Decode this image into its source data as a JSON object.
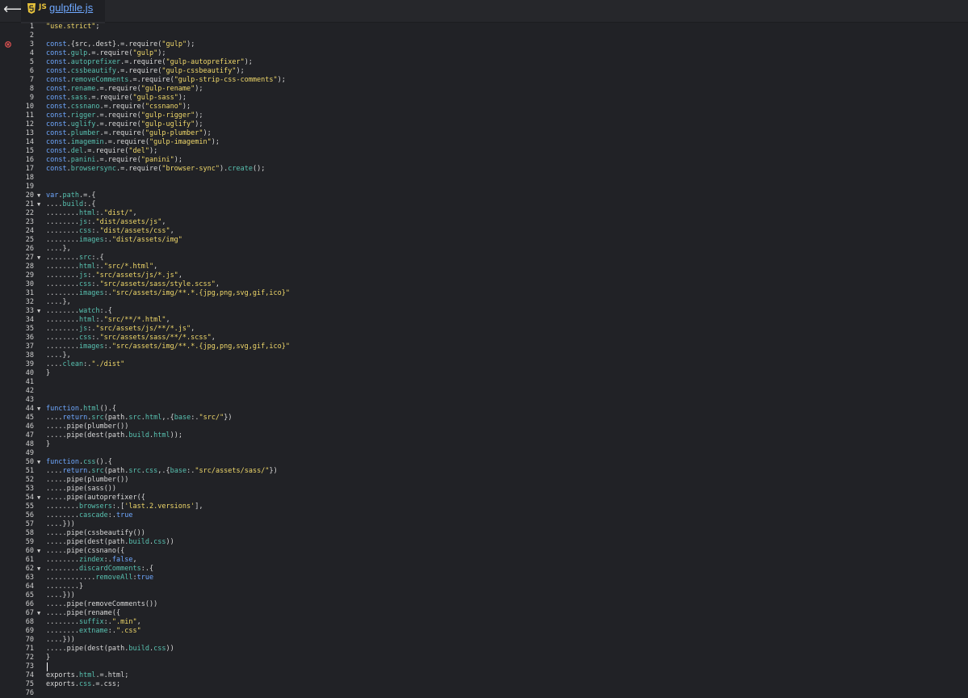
{
  "header": {
    "back_glyph": "⟵",
    "tab": {
      "js_badge": "JS",
      "filename": "gulpfile.js"
    }
  },
  "colors": {
    "background": "#212226",
    "keyword": "#6fa8ff",
    "property": "#58c1b0",
    "string": "#f0d86a",
    "error": "#e05252",
    "text": "#d8d8d8"
  },
  "editor": {
    "error_line": 3,
    "caret_line": 73,
    "fold_lines": [
      20,
      21,
      27,
      33,
      44,
      50,
      54,
      60,
      62,
      67
    ],
    "lines": [
      "\"use.strict\";",
      "",
      "const.{src,.dest}.=.require(\"gulp\");",
      "const.gulp.=.require(\"gulp\");",
      "const.autoprefixer.=.require(\"gulp-autoprefixer\");",
      "const.cssbeautify.=.require(\"gulp-cssbeautify\");",
      "const.removeComments.=.require(\"gulp-strip-css-comments\");",
      "const.rename.=.require(\"gulp-rename\");",
      "const.sass.=.require(\"gulp-sass\");",
      "const.cssnano.=.require(\"cssnano\");",
      "const.rigger.=.require(\"gulp-rigger\");",
      "const.uglify.=.require(\"gulp-uglify\");",
      "const.plumber.=.require(\"gulp-plumber\");",
      "const.imagemin.=.require(\"gulp-imagemin\");",
      "const.del.=.require(\"del\");",
      "const.panini.=.require(\"panini\");",
      "const.browsersync.=.require(\"browser-sync\").create();",
      "",
      "",
      "var.path.=.{",
      "....build:.{",
      "........html:.\"dist/\",",
      "........js:.\"dist/assets/js\",",
      "........css:.\"dist/assets/css\",",
      "........images:.\"dist/assets/img\"",
      "....},",
      "........src:.{",
      "........html:.\"src/*.html\",",
      "........js:.\"src/assets/js/*.js\",",
      "........css:.\"src/assets/sass/style.scss\",",
      "........images:.\"src/assets/img/**.*.{jpg,png,svg,gif,ico}\"",
      "....},",
      "........watch:.{",
      "........html:.\"src/**/*.html\",",
      "........js:.\"src/assets/js/**/*.js\",",
      "........css:.\"src/assets/sass/**/*.scss\",",
      "........images:.\"src/assets/img/**.*.{jpg,png,svg,gif,ico}\"",
      "....},",
      "....clean:.\"./dist\"",
      "}",
      "",
      "",
      "",
      "function.html().{",
      "....return.src(path.src.html,.{base:.\"src/\"})",
      ".....pipe(plumber())",
      ".....pipe(dest(path.build.html));",
      "}",
      "",
      "function.css().{",
      "....return.src(path.src.css,.{base:.\"src/assets/sass/\"})",
      ".....pipe(plumber())",
      ".....pipe(sass())",
      ".....pipe(autoprefixer({",
      "........browsers:.['last.2.versions'],",
      "........cascade:.true",
      "....}))",
      ".....pipe(cssbeautify())",
      ".....pipe(dest(path.build.css))",
      ".....pipe(cssnano({",
      "........zindex:.false,",
      "........discardComments:.{",
      "............removeAll:true",
      "........}",
      "....}))",
      ".....pipe(removeComments())",
      ".....pipe(rename({",
      "........suffix:.\".min\",",
      "........extname:.\".css\"",
      "....}))",
      ".....pipe(dest(path.build.css))",
      "}",
      "",
      "exports.html.=.html;",
      "exports.css.=.css;",
      ""
    ]
  }
}
